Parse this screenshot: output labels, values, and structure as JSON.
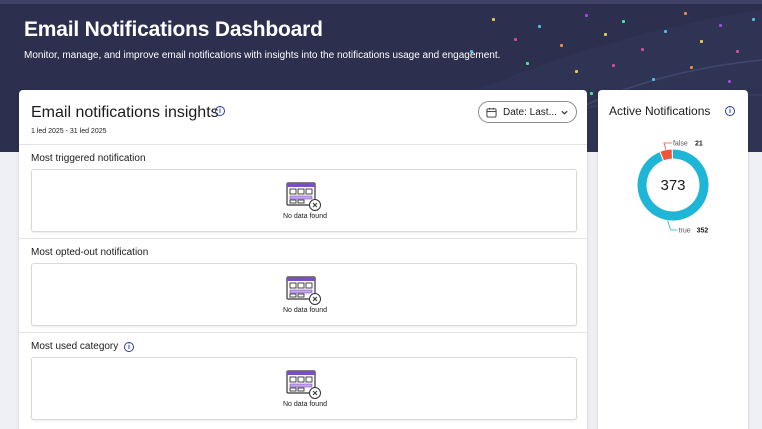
{
  "header": {
    "title": "Email Notifications Dashboard",
    "subtitle": "Monitor, manage, and improve email notifications with insights into the notifications usage and engagement."
  },
  "insights": {
    "title": "Email notifications insights",
    "info_icon": "info-icon",
    "date_range": "1 led 2025 - 31 led 2025",
    "date_button": {
      "label": "Date: Last...",
      "icon": "calendar-icon",
      "chevron": "chevron-down-icon"
    },
    "sections": [
      {
        "label": "Most triggered notification",
        "empty_text": "No data found",
        "has_info": false
      },
      {
        "label": "Most opted-out notification",
        "empty_text": "No data found",
        "has_info": false
      },
      {
        "label": "Most used category",
        "empty_text": "No data found",
        "has_info": true
      }
    ]
  },
  "active": {
    "title": "Active Notifications",
    "info_icon": "info-icon",
    "total": "373"
  },
  "colors": {
    "hero_bg": "#2c2f4d",
    "true_color": "#1fb5d6",
    "false_color": "#f0543a",
    "accent": "#2f3aa8"
  },
  "chart_data": {
    "type": "pie",
    "donut": true,
    "center_label": "373",
    "categories": [
      "false",
      "true"
    ],
    "values": [
      21,
      352
    ],
    "colors": [
      "#f0543a",
      "#1fb5d6"
    ]
  }
}
